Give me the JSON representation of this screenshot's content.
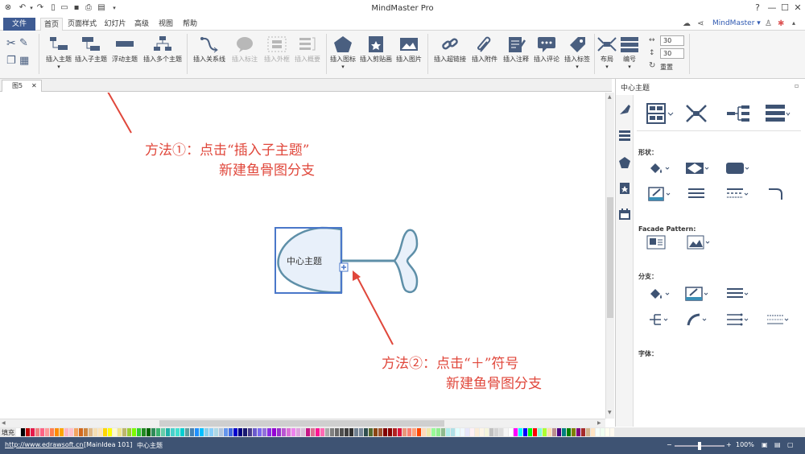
{
  "titlebar": {
    "app_title": "MindMaster Pro",
    "quick_access_icons": [
      "app-logo-icon",
      "undo-icon",
      "undo-dropdown-icon",
      "redo-icon",
      "new-icon",
      "open-icon",
      "save-icon",
      "print-icon",
      "export-icon",
      "customize-icon"
    ],
    "window_buttons": [
      "?",
      "—",
      "☐",
      "✕"
    ]
  },
  "menubar": {
    "items": [
      "文件",
      "首页",
      "页面样式",
      "幻灯片",
      "高级",
      "视图",
      "帮助"
    ],
    "active": "首页",
    "brand": "MindMaster ▾",
    "right_icons": [
      "cloud-icon",
      "share-icon",
      "shirt-icon",
      "settings-icon"
    ]
  },
  "ribbon": {
    "buttons": [
      {
        "label": "插入主题",
        "enabled": true
      },
      {
        "label": "插入子主题",
        "enabled": true
      },
      {
        "label": "浮动主题",
        "enabled": true
      },
      {
        "label": "插入多个主题",
        "enabled": true
      },
      {
        "label": "插入关系线",
        "enabled": true
      },
      {
        "label": "插入标注",
        "enabled": false
      },
      {
        "label": "插入外框",
        "enabled": false
      },
      {
        "label": "插入概要",
        "enabled": false
      },
      {
        "label": "插入图标",
        "enabled": true
      },
      {
        "label": "插入剪贴画",
        "enabled": true
      },
      {
        "label": "插入图片",
        "enabled": true
      },
      {
        "label": "插入超链接",
        "enabled": true
      },
      {
        "label": "插入附件",
        "enabled": true
      },
      {
        "label": "插入注释",
        "enabled": true
      },
      {
        "label": "插入评论",
        "enabled": true
      },
      {
        "label": "插入标签",
        "enabled": true
      },
      {
        "label": "布局",
        "enabled": true
      },
      {
        "label": "编号",
        "enabled": true
      }
    ],
    "spin1": "30",
    "spin2": "30",
    "reset": "重置"
  },
  "doc_tab": {
    "label": "图5"
  },
  "canvas": {
    "central_topic": "中心主题",
    "annotation1_line1": "方法①：点击“插入子主题”",
    "annotation1_line2": "新建鱼骨图分支",
    "annotation2_line1": "方法②：点击“＋”符号",
    "annotation2_line2": "新建鱼骨图分支",
    "annotation_color": "#e0473b"
  },
  "panel": {
    "title": "中心主题",
    "shape_label": "形状：",
    "facade_label": "Facade Pattern:",
    "branch_label": "分支：",
    "font_label": "字体："
  },
  "palette": {
    "fill_label": "填充",
    "colors": [
      "#ffffff",
      "#000000",
      "#c00000",
      "#e6194b",
      "#f08080",
      "#ff6384",
      "#ff9999",
      "#ff7f50",
      "#ff8c00",
      "#ffa500",
      "#ffb6c1",
      "#ffc0cb",
      "#f4a460",
      "#d2691e",
      "#cd853f",
      "#deb887",
      "#f5deb3",
      "#ffe4b5",
      "#ffd700",
      "#ffff00",
      "#fffacd",
      "#f0e68c",
      "#bdb76b",
      "#9acd32",
      "#7cfc00",
      "#32cd32",
      "#228b22",
      "#006400",
      "#2e8b57",
      "#3cb371",
      "#66cdaa",
      "#20b2aa",
      "#48d1cc",
      "#40e0d0",
      "#00ced1",
      "#5f9ea0",
      "#4682b4",
      "#1e90ff",
      "#00bfff",
      "#87ceeb",
      "#87cefa",
      "#add8e6",
      "#b0c4de",
      "#6495ed",
      "#4169e1",
      "#0000cd",
      "#000080",
      "#191970",
      "#483d8b",
      "#6a5acd",
      "#7b68ee",
      "#9370db",
      "#8a2be2",
      "#9400d3",
      "#9932cc",
      "#ba55d3",
      "#da70d6",
      "#ee82ee",
      "#dda0dd",
      "#d8bfd8",
      "#c71585",
      "#db7093",
      "#ff1493",
      "#ff69b4",
      "#a9a9a9",
      "#808080",
      "#696969",
      "#505050",
      "#404040",
      "#303030",
      "#708090",
      "#778899",
      "#2f4f4f",
      "#556b2f",
      "#8b4513",
      "#a0522d",
      "#800000",
      "#8b0000",
      "#b22222",
      "#dc143c",
      "#e9967a",
      "#fa8072",
      "#ffa07a",
      "#ff4500",
      "#ffdab9",
      "#eee8aa",
      "#98fb98",
      "#90ee90",
      "#8fbc8f",
      "#afeeee",
      "#b0e0e6",
      "#e0ffff",
      "#f0f8ff",
      "#e6e6fa",
      "#fff0f5",
      "#faebd7",
      "#fdf5e6",
      "#f5f5dc",
      "#c0c0c0",
      "#d3d3d3",
      "#dcdcdc",
      "#f5f5f5",
      "#ffffff",
      "#ff00ff",
      "#00ffff",
      "#0000ff",
      "#00ff00",
      "#ff0000",
      "#7fffd4",
      "#adff2f",
      "#ffdead",
      "#bc8f8f",
      "#4b0082",
      "#008080",
      "#008000",
      "#808000",
      "#800080",
      "#a52a2a",
      "#d2b48c",
      "#ffe4c4",
      "#f5fffa",
      "#f0fff0",
      "#fffff0",
      "#fffaf0"
    ]
  },
  "statusbar": {
    "url": "http://www.edrawsoft.cn",
    "main_idea": "[MainIdea 101]",
    "topic": "中心主题",
    "zoom": "100%",
    "zoom_level": 0.5
  }
}
